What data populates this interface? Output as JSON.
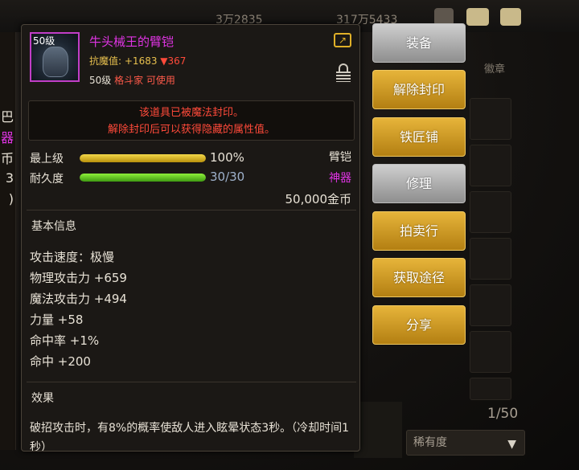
{
  "topbar": {
    "value_left": "3万2835",
    "value_right": "317万5433"
  },
  "left_panel": {
    "fragments": [
      "巴",
      "器",
      "币",
      "3",
      ")"
    ]
  },
  "item": {
    "level_badge": "50级",
    "name": "牛头械王的臂铠",
    "resist_label": "抗魔值:",
    "resist_value": "+1683",
    "resist_down": "▼367",
    "level_req": "50级",
    "job": "格斗家 可使用",
    "seal_line1": "该道具已被魔法封印。",
    "seal_line2": "解除封印后可以获得隐藏的属性值。",
    "max_level_label": "最上级",
    "max_level_value": "100%",
    "max_level_fraction": 1.0,
    "durability_label": "耐久度",
    "durability_value": "30/30",
    "durability_fraction": 1.0,
    "type": "臂铠",
    "rarity": "神器",
    "price": "50,000金币",
    "basic_info_title": "基本信息",
    "stats": [
      "攻击速度：极慢",
      "物理攻击力 +659",
      "魔法攻击力 +494",
      "力量 +58",
      "命中率 +1%",
      "命中 +200"
    ],
    "effect_title": "效果",
    "effect_text": "破招攻击时，有8%的概率使敌人进入眩晕状态3秒。（冷却时间1秒）"
  },
  "buttons": {
    "equip": "装备",
    "unseal": "解除封印",
    "blacksmith": "铁匠铺",
    "repair": "修理",
    "auction": "拍卖行",
    "obtain": "获取途径",
    "share": "分享"
  },
  "inventory": {
    "tab_label": "徽章",
    "counter": "1/50",
    "sort_label": "稀有度"
  },
  "colors": {
    "item_name": "#e034e4",
    "rarity_text": "#e034e4",
    "warning_red": "#ff4a3a",
    "resist_gold": "#e8c04e",
    "button_gold": "#d8a428",
    "button_gray": "#b0b0b0",
    "bar_yellow": "#e6c21c",
    "bar_green": "#6ad12a"
  },
  "icons": {
    "share": "share-icon",
    "lock": "lock-icon",
    "sort_arrow": "dropdown-triangle-icon"
  }
}
